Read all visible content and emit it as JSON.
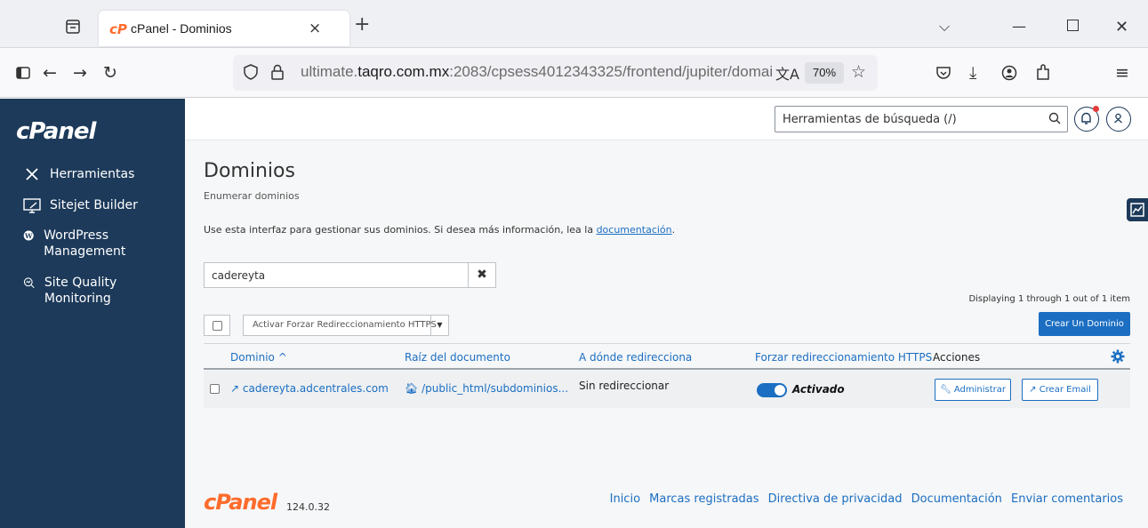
{
  "browser": {
    "tab_title": "cPanel - Dominios",
    "tab_close": "×",
    "new_tab": "+",
    "url_prefix": "ultimate.",
    "url_host": "taqro.com.mx",
    "url_rest": ":2083/cpsess4012343325/frontend/jupiter/domai",
    "zoom": "70%"
  },
  "sidebar": {
    "logo": "cPanel",
    "items": [
      {
        "label": "Herramientas",
        "icon": "tools-icon"
      },
      {
        "label": "Sitejet Builder",
        "icon": "monitor-icon"
      },
      {
        "label": "WordPress Management",
        "icon": "wordpress-icon"
      },
      {
        "label": "Site Quality Monitoring",
        "icon": "magnifier-icon"
      }
    ]
  },
  "header": {
    "search_placeholder": "Herramientas de búsqueda (/)"
  },
  "page": {
    "title": "Dominios",
    "subtitle": "Enumerar dominios",
    "description": "Use esta interfaz para gestionar sus dominios. Si desea más información, lea la ",
    "doc_link": "documentación",
    "doc_link_suffix": ".",
    "filter_value": "cadereyta",
    "count_text": "Displaying 1 through 1 out of 1 item",
    "bulk_action": "Activar Forzar Redireccionamiento HTTPS",
    "create_button": "Crear Un Dominio"
  },
  "table": {
    "columns": [
      "Dominio ^",
      "Raíz del documento",
      "A dónde redirecciona",
      "Forzar redireccionamiento HTTPS",
      "Acciones"
    ],
    "rows": [
      {
        "domain": "cadereyta.adcentrales.com",
        "docroot": "/public_html/subdominios...",
        "redirect": "Sin redireccionar",
        "https": "Activado",
        "https_on": true,
        "manage": "Administrar",
        "email": "Crear Email"
      }
    ]
  },
  "footer": {
    "logo": "cPanel",
    "version": "124.0.32",
    "links": [
      "Inicio",
      "Marcas registradas",
      "Directiva de privacidad",
      "Documentación",
      "Enviar comentarios"
    ]
  },
  "colors": {
    "sidebar": "#1d3a5a",
    "accent": "#1b6ec2",
    "brand": "#ff6c2c"
  }
}
